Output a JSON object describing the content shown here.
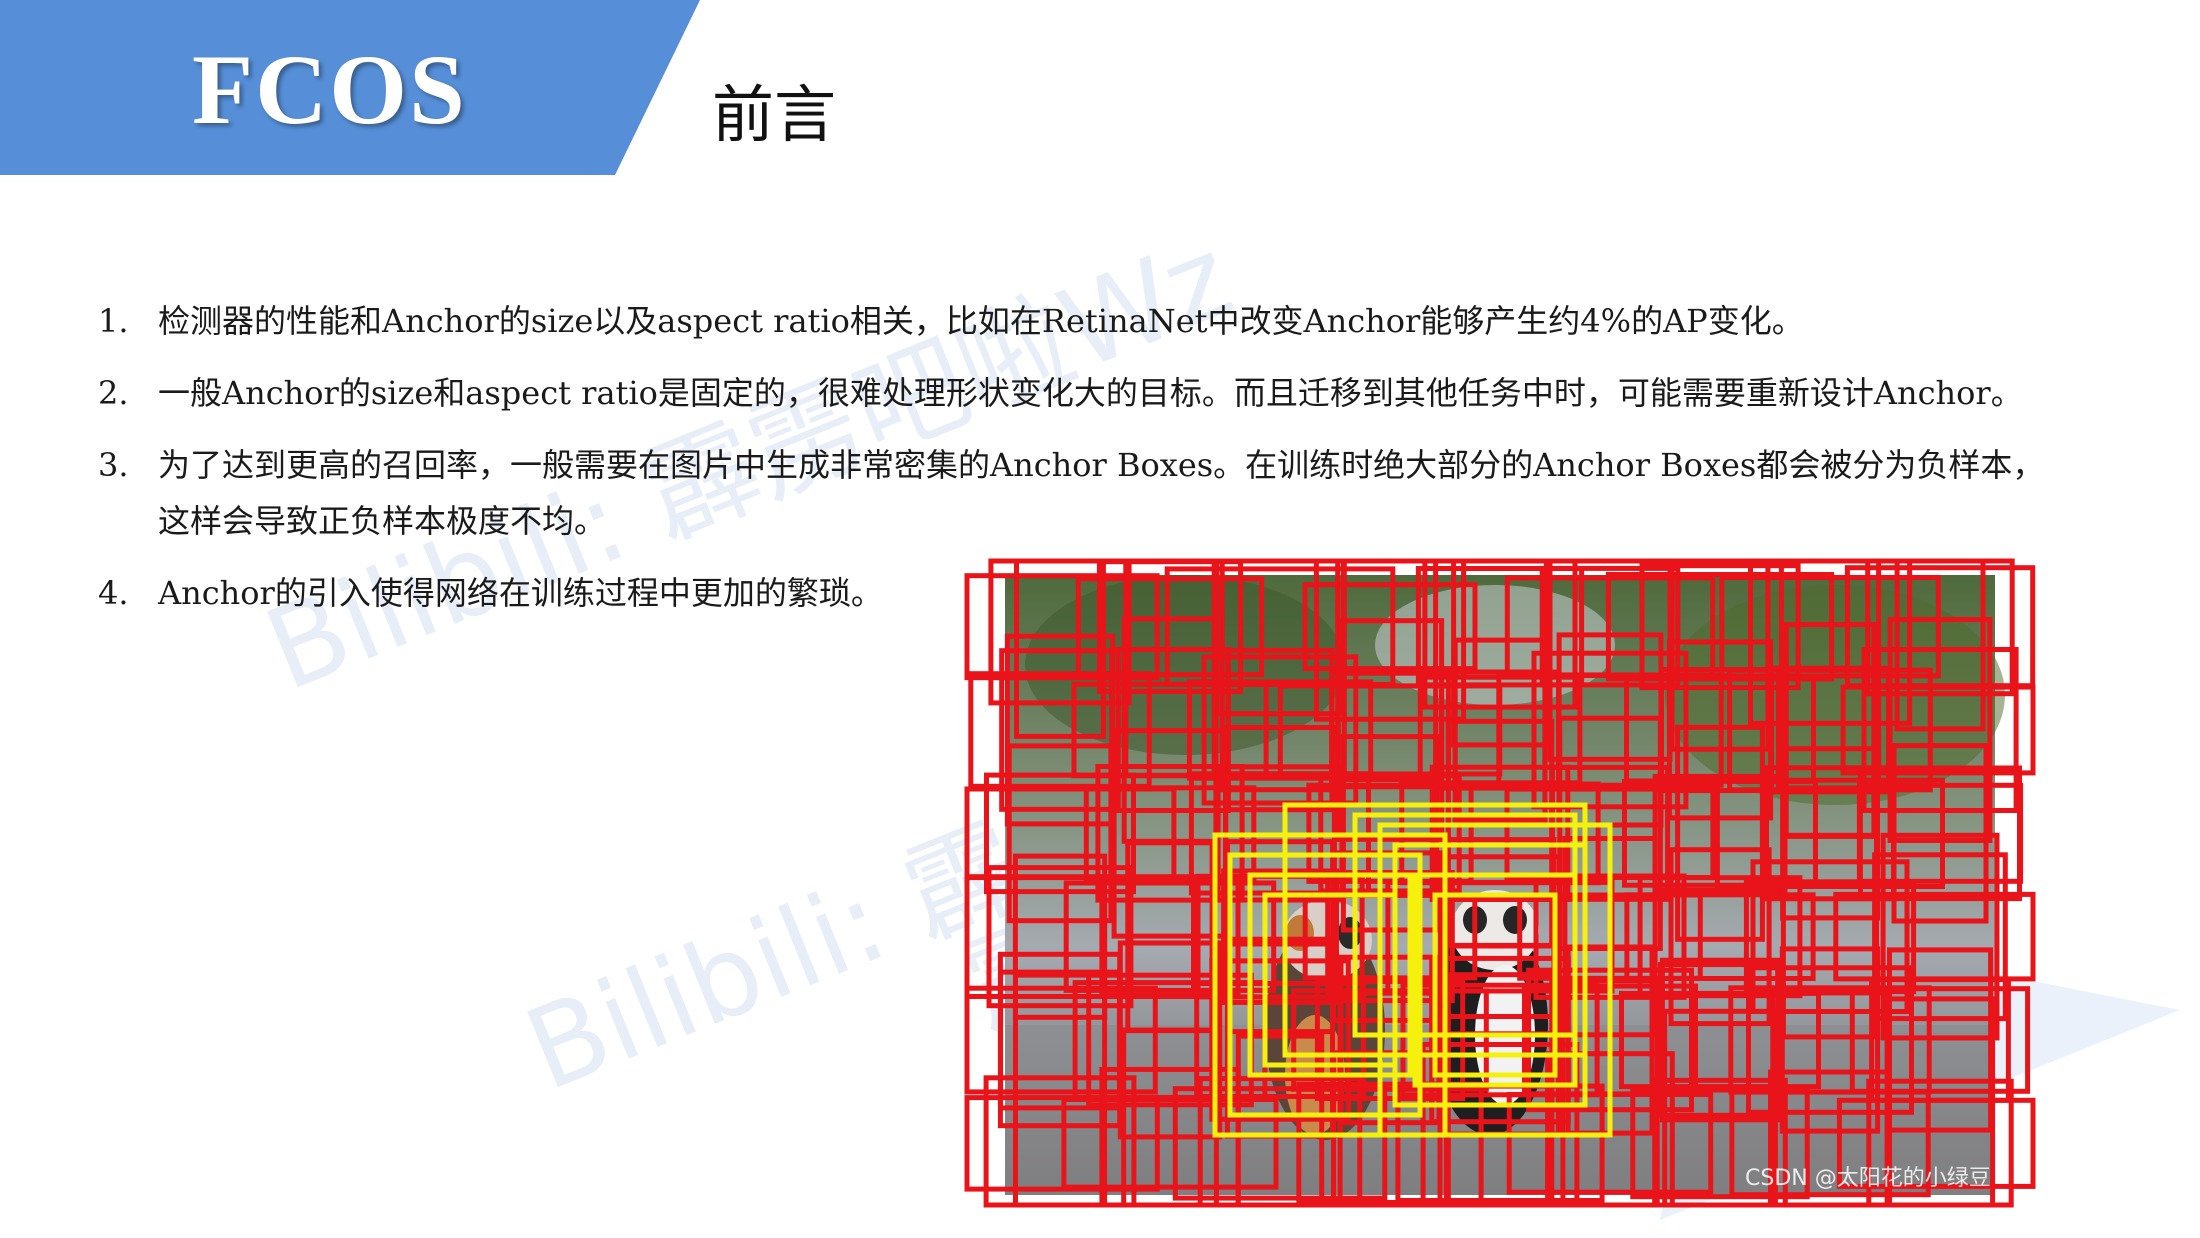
{
  "header": {
    "logo": "FCOS",
    "title": "前言"
  },
  "items": [
    {
      "num": "1.",
      "lines": [
        "检测器的性能和Anchor的size以及aspect ratio相关，比如在RetinaNet中改变Anchor能够产生约4%的AP变化。"
      ]
    },
    {
      "num": "2.",
      "lines": [
        "一般Anchor的size和aspect ratio是固定的，很难处理形状变化大的目标。而且迁移到其他任务中时，可能需要重新设计Anchor。"
      ]
    },
    {
      "num": "3.",
      "lines": [
        "为了达到更高的召回率，一般需要在图片中生成非常密集的Anchor Boxes。在训练时绝大部分的Anchor Boxes都会被分为负样本，",
        "这样会导致正负样本极度不均。"
      ]
    },
    {
      "num": "4.",
      "lines": [
        "Anchor的引入使得网络在训练过程中更加的繁琐。"
      ]
    }
  ],
  "watermarks": [
    "Bilibili: 霹雳吧啦Wz",
    "Bilibili: 霹雳吧啦Wz",
    "霹雳吧啦Wz"
  ],
  "figure_credit": "CSDN @太阳花的小绿豆",
  "colors": {
    "header_blue": "#568fd8",
    "anchor_negative": "#e8141a",
    "anchor_positive": "#f5f00c"
  }
}
